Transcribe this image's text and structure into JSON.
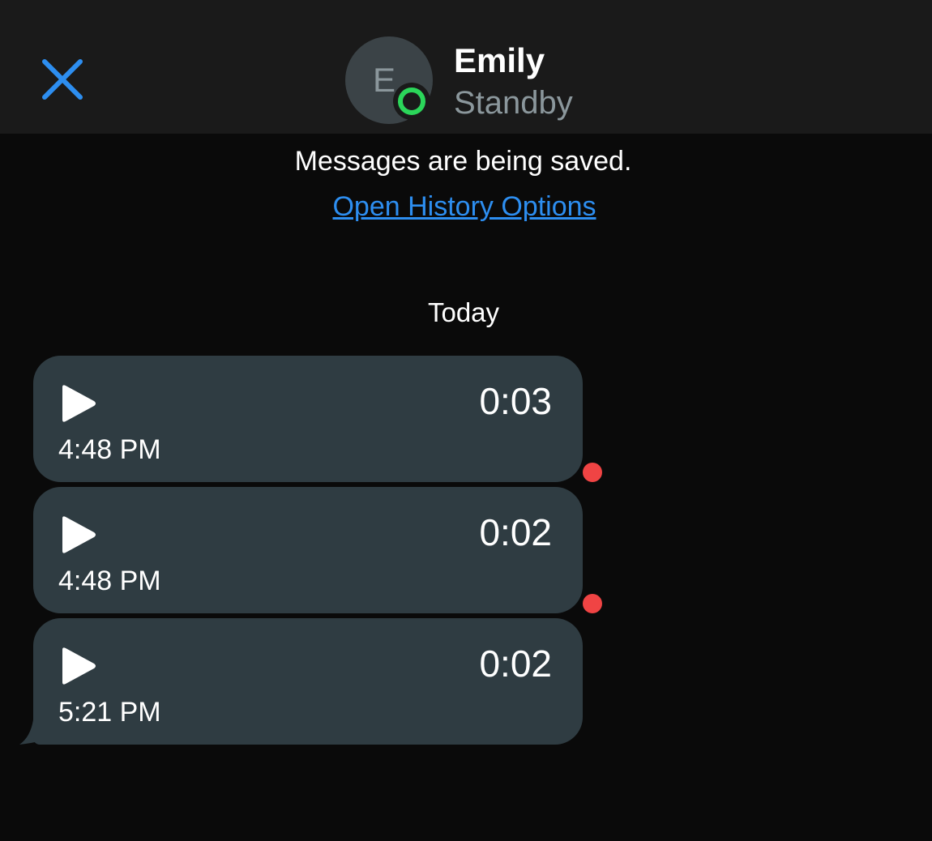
{
  "header": {
    "avatar_initial": "E",
    "contact_name": "Emily",
    "contact_status": "Standby",
    "presence_color": "#2bd65a"
  },
  "history": {
    "notice": "Messages are being saved.",
    "link_label": "Open History Options"
  },
  "date_separator": "Today",
  "messages": [
    {
      "duration": "0:03",
      "time": "4:48 PM",
      "unread": true
    },
    {
      "duration": "0:02",
      "time": "4:48 PM",
      "unread": true
    },
    {
      "duration": "0:02",
      "time": "5:21 PM",
      "unread": false
    }
  ],
  "colors": {
    "background": "#0a0a0a",
    "header_background": "#1a1a1a",
    "bubble": "#2f3c42",
    "accent": "#2d8ef0",
    "unread": "#f04444"
  },
  "icons": {
    "close": "close-icon",
    "play": "play-icon",
    "presence": "presence-ring-icon"
  }
}
